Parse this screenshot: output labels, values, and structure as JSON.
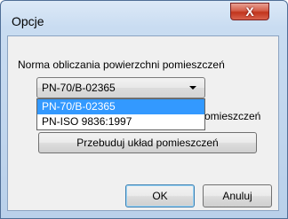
{
  "window": {
    "title": "Opcje",
    "close_glyph": "X"
  },
  "norm": {
    "label": "Norma obliczania powierzchni pomieszczeń",
    "selected": "PN-70/B-02365",
    "options": [
      "PN-70/B-02365",
      "PN-ISO 9836:1997"
    ]
  },
  "hidden_text": "omieszczeń",
  "buttons": {
    "rebuild": "Przebuduj układ pomieszczeń",
    "ok": "OK",
    "cancel": "Anuluj"
  }
}
